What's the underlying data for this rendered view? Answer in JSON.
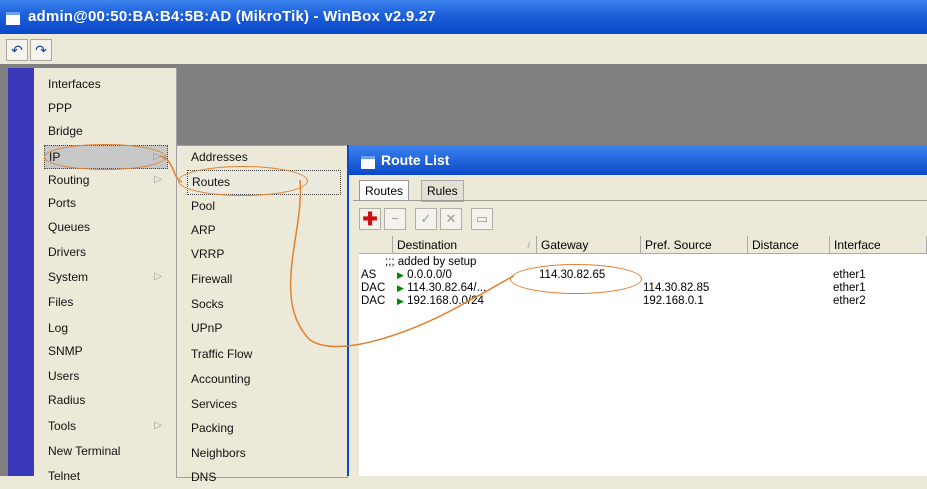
{
  "window": {
    "title": "admin@00:50:BA:B4:5B:AD (MikroTik) - WinBox v2.9.27"
  },
  "toolbar": {
    "undo": "↶",
    "redo": "↷"
  },
  "main_menu": [
    {
      "label": "Interfaces",
      "arrow": false
    },
    {
      "label": "PPP",
      "arrow": false
    },
    {
      "label": "Bridge",
      "arrow": false
    },
    {
      "label": "IP",
      "arrow": true
    },
    {
      "label": "Routing",
      "arrow": true
    },
    {
      "label": "Ports",
      "arrow": false
    },
    {
      "label": "Queues",
      "arrow": false
    },
    {
      "label": "Drivers",
      "arrow": false
    },
    {
      "label": "System",
      "arrow": true
    },
    {
      "label": "Files",
      "arrow": false
    },
    {
      "label": "Log",
      "arrow": false
    },
    {
      "label": "SNMP",
      "arrow": false
    },
    {
      "label": "Users",
      "arrow": false
    },
    {
      "label": "Radius",
      "arrow": false
    },
    {
      "label": "Tools",
      "arrow": true
    },
    {
      "label": "New Terminal",
      "arrow": false
    },
    {
      "label": "Telnet",
      "arrow": false
    }
  ],
  "ip_submenu": [
    "Addresses",
    "Routes",
    "Pool",
    "ARP",
    "VRRP",
    "Firewall",
    "Socks",
    "UPnP",
    "Traffic Flow",
    "Accounting",
    "Services",
    "Packing",
    "Neighbors",
    "DNS"
  ],
  "route_window": {
    "title": "Route List",
    "tabs": [
      "Routes",
      "Rules"
    ],
    "columns": [
      "Destination",
      "Gateway",
      "Pref. Source",
      "Distance",
      "Interface"
    ],
    "comment": ";;; added by setup",
    "rows": [
      {
        "flags": "AS",
        "destination": "0.0.0.0/0",
        "gateway": "114.30.82.65",
        "pref_source": "",
        "distance": "",
        "interface": "ether1"
      },
      {
        "flags": "DAC",
        "destination": "114.30.82.64/...",
        "gateway": "",
        "pref_source": "114.30.82.85",
        "distance": "",
        "interface": "ether1"
      },
      {
        "flags": "DAC",
        "destination": "192.168.0.0/24",
        "gateway": "",
        "pref_source": "192.168.0.1",
        "distance": "",
        "interface": "ether2"
      }
    ]
  },
  "colors": {
    "titlebar": "#0a48c8",
    "menu_bg": "#ece9d8",
    "annotation": "#e08030"
  }
}
